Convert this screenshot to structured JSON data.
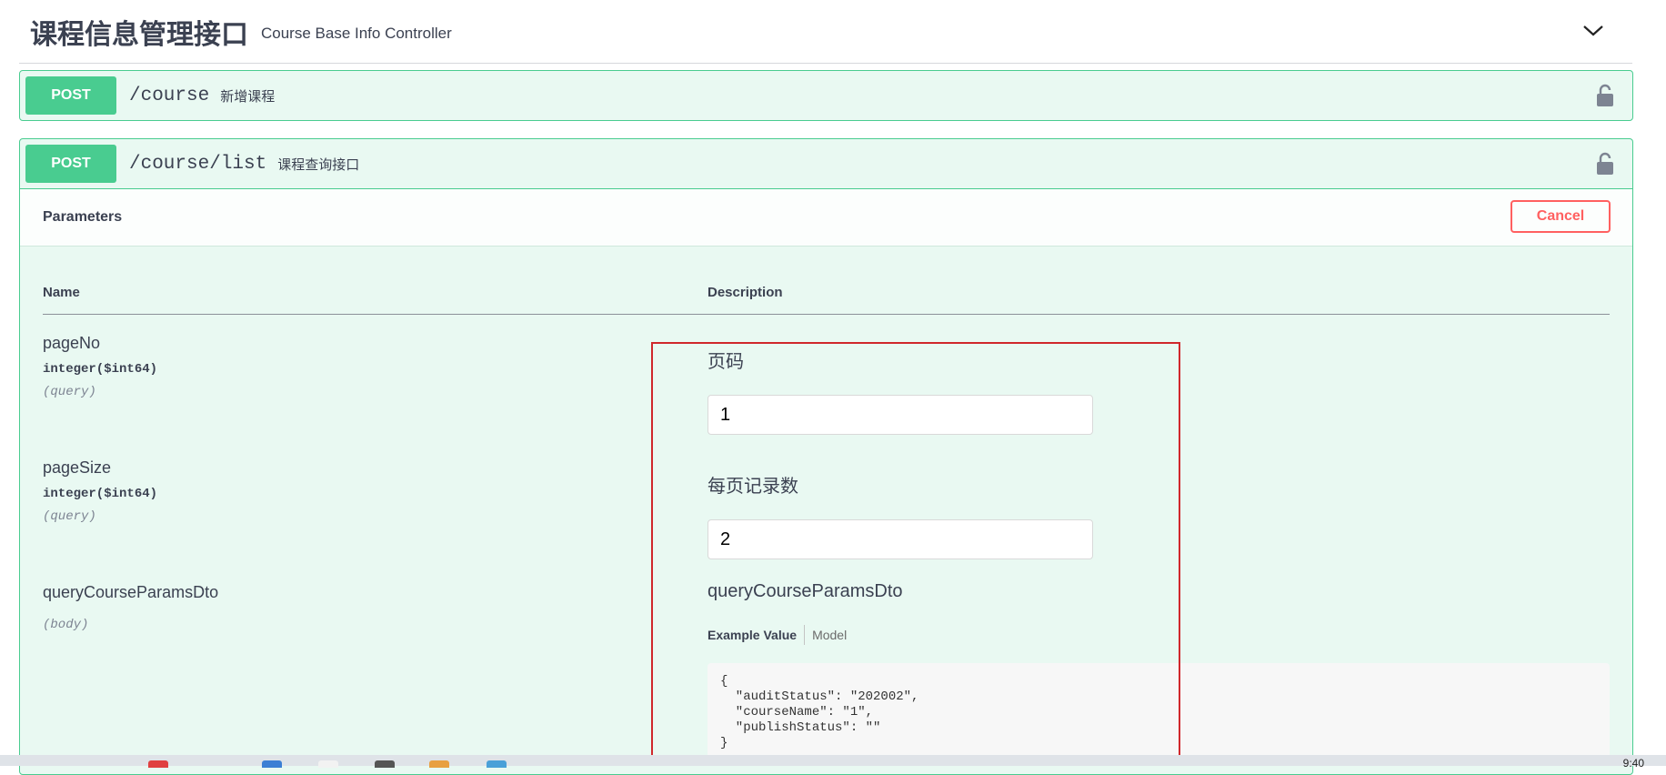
{
  "tag": {
    "name": "课程信息管理接口",
    "description": "Course Base Info Controller"
  },
  "operations": [
    {
      "method": "POST",
      "path": "/course",
      "summary": "新增课程"
    },
    {
      "method": "POST",
      "path": "/course/list",
      "summary": "课程查询接口"
    }
  ],
  "params_section": {
    "title": "Parameters",
    "cancel_label": "Cancel",
    "name_header": "Name",
    "description_header": "Description"
  },
  "parameters": [
    {
      "name": "pageNo",
      "type": "integer($int64)",
      "in": "(query)",
      "description": "页码",
      "value": "1"
    },
    {
      "name": "pageSize",
      "type": "integer($int64)",
      "in": "(query)",
      "description": "每页记录数",
      "value": "2"
    },
    {
      "name": "queryCourseParamsDto",
      "type": "",
      "in": "(body)",
      "description": "queryCourseParamsDto",
      "example_tab": "Example Value",
      "model_tab": "Model",
      "example_json": "{\n  \"auditStatus\": \"202002\",\n  \"courseName\": \"1\",\n  \"publishStatus\": \"\"\n}"
    }
  ],
  "icons": [
    "chevron-down-icon",
    "lock-icon"
  ],
  "colors": {
    "post": "#49cc90",
    "cancel": "#ff6060",
    "highlight": "#d0282c"
  },
  "taskbar": {
    "clock": "9:40"
  }
}
